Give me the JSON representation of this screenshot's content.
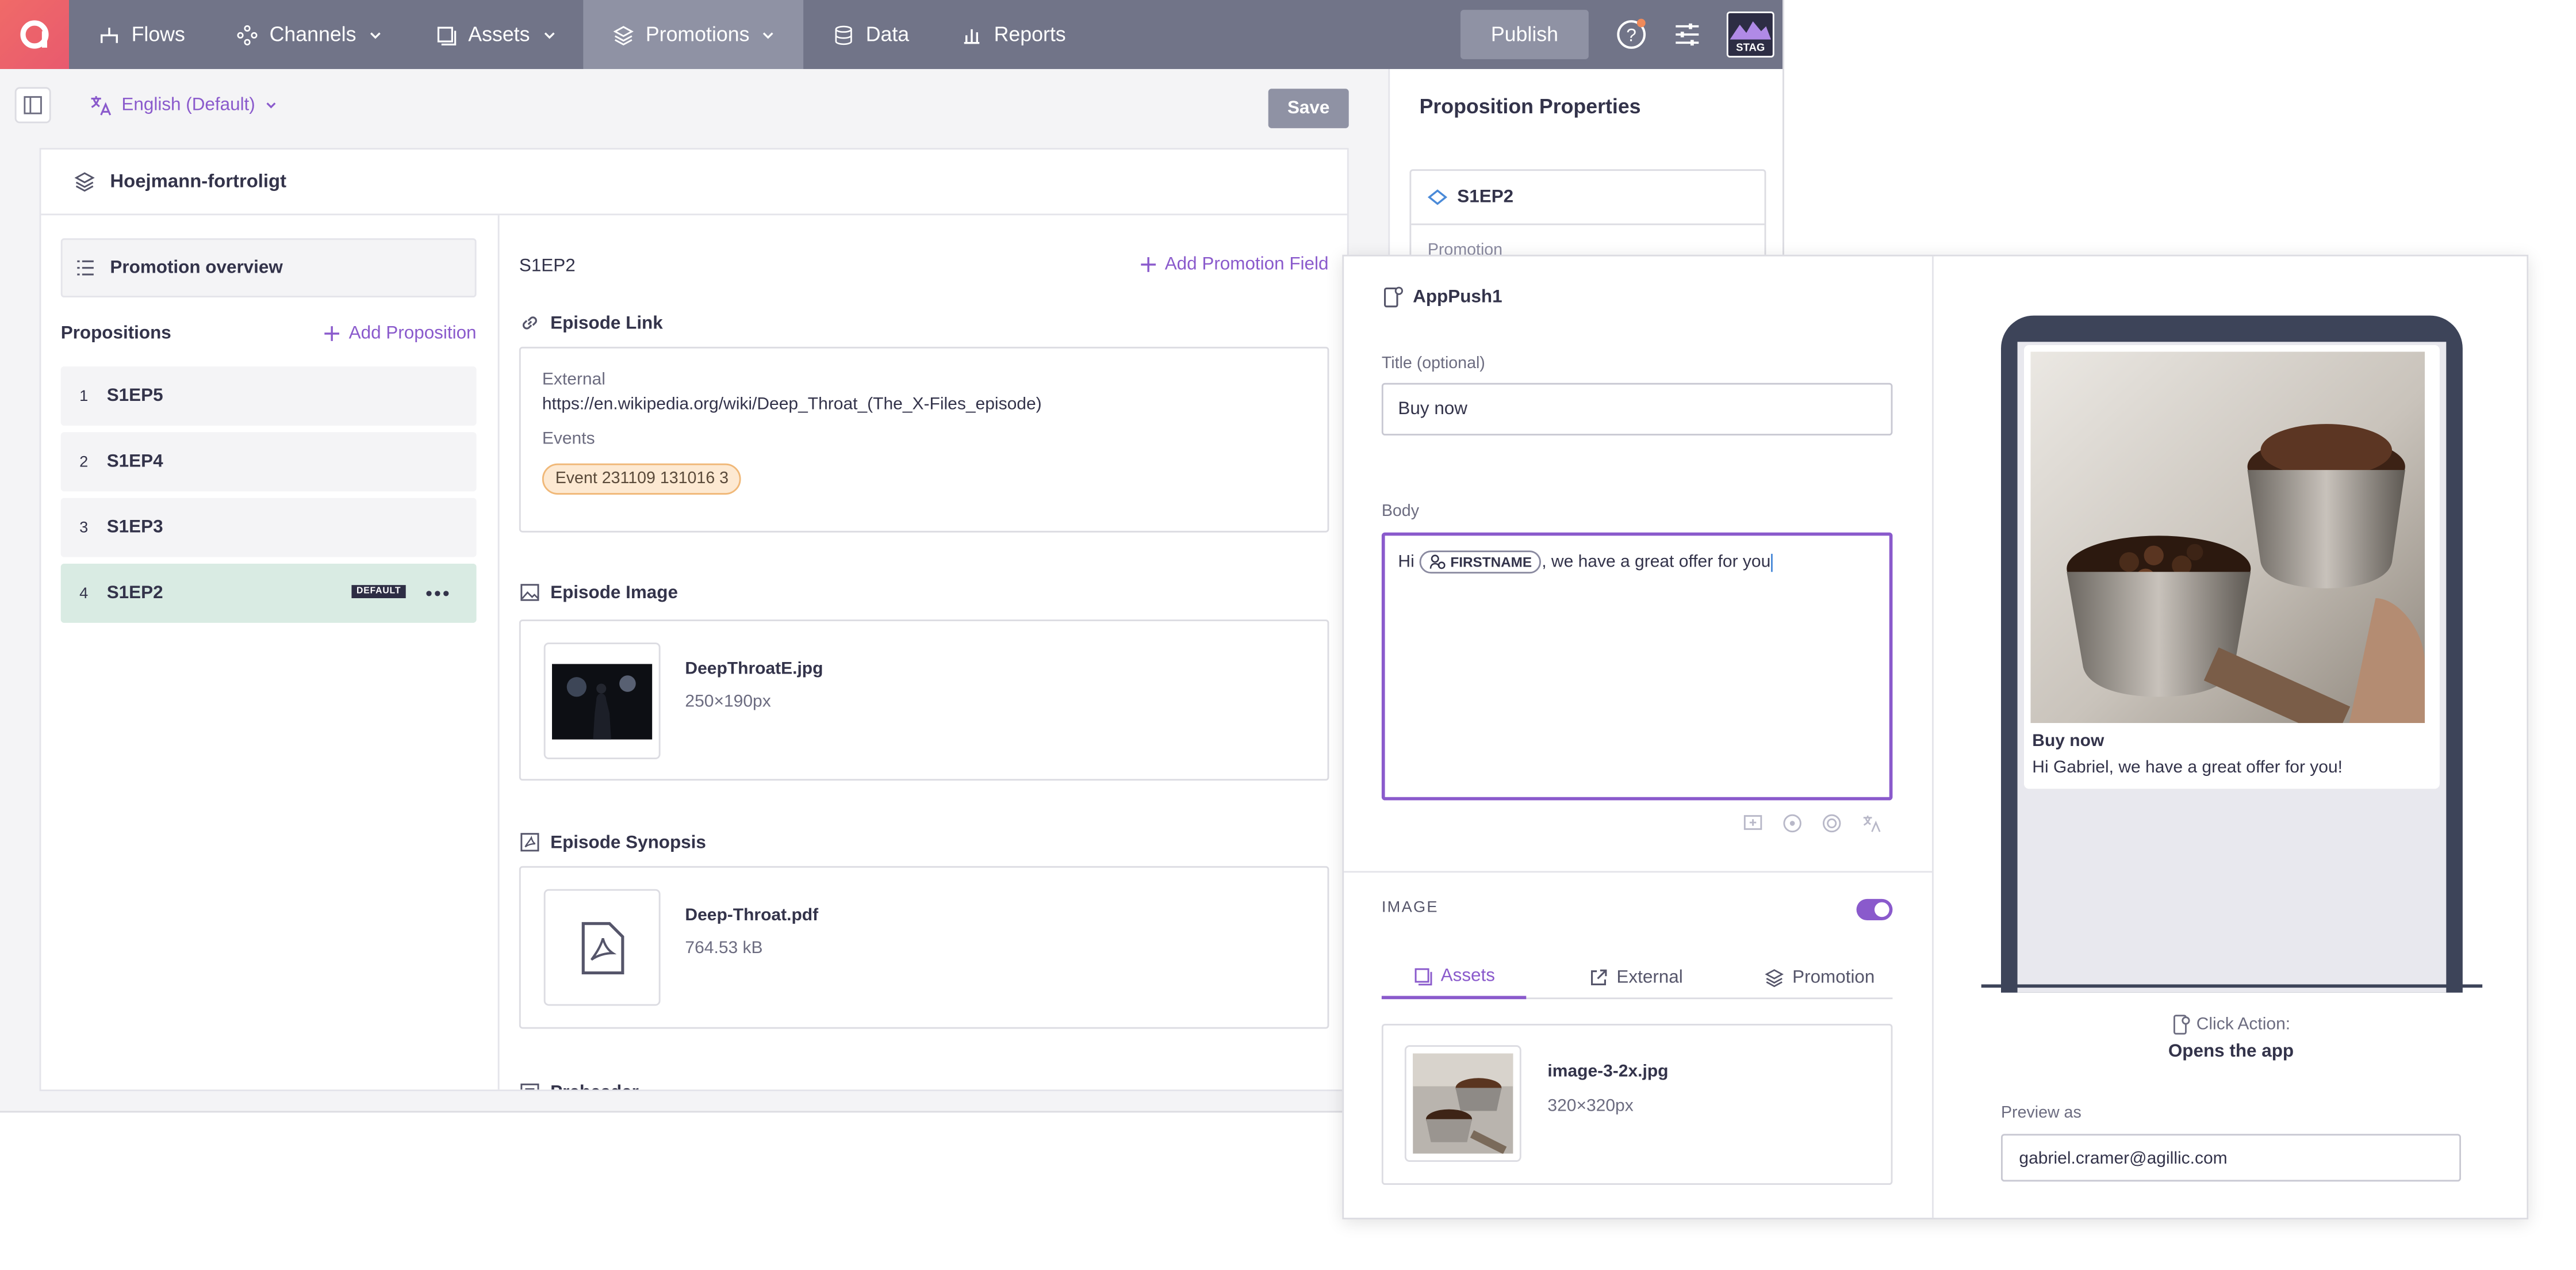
{
  "nav": {
    "items": [
      {
        "label": "Flows"
      },
      {
        "label": "Channels"
      },
      {
        "label": "Assets"
      },
      {
        "label": "Promotions"
      },
      {
        "label": "Data"
      },
      {
        "label": "Reports"
      }
    ],
    "publish": "Publish",
    "env_badge": "STAG"
  },
  "toolbar": {
    "language": "English (Default)",
    "save": "Save"
  },
  "promotion": {
    "name": "Hoejmann-fortroligt",
    "overview": "Promotion overview",
    "propositions_title": "Propositions",
    "add_proposition": "Add Proposition",
    "propositions": [
      {
        "n": "1",
        "label": "S1EP5"
      },
      {
        "n": "2",
        "label": "S1EP4"
      },
      {
        "n": "3",
        "label": "S1EP3"
      },
      {
        "n": "4",
        "label": "S1EP2",
        "badge": "DEFAULT"
      }
    ]
  },
  "detail": {
    "title": "S1EP2",
    "add_field": "Add Promotion Field",
    "episode_link": {
      "title": "Episode Link",
      "external_label": "External",
      "url": "https://en.wikipedia.org/wiki/Deep_Throat_(The_X-Files_episode)",
      "events_label": "Events",
      "event_chip": "Event 231109 131016 3"
    },
    "episode_image": {
      "title": "Episode Image",
      "file": "DeepThroatE.jpg",
      "size": "250×190px"
    },
    "episode_synopsis": {
      "title": "Episode Synopsis",
      "file": "Deep-Throat.pdf",
      "size": "764.53 kB"
    },
    "preheader": {
      "title": "Preheader"
    }
  },
  "properties": {
    "title": "Proposition Properties",
    "item": "S1EP2",
    "sub": "Promotion"
  },
  "push": {
    "name": "AppPush1",
    "title_label": "Title (optional)",
    "title_value": "Buy now",
    "body_label": "Body",
    "body_prefix": "Hi",
    "body_token": "FIRSTNAME",
    "body_suffix": ", we have a great offer for you",
    "image_label": "IMAGE",
    "tabs": [
      {
        "label": "Assets"
      },
      {
        "label": "External"
      },
      {
        "label": "Promotion"
      }
    ],
    "asset_file": "image-3-2x.jpg",
    "asset_size": "320×320px"
  },
  "preview": {
    "notif_title": "Buy now",
    "notif_body": "Hi Gabriel, we have a great offer for you!",
    "click_action_label": "Click Action:",
    "click_action_value": "Opens the app",
    "preview_as_label": "Preview as",
    "preview_as_value": "gabriel.cramer@agillic.com"
  },
  "colors": {
    "nav_bg": "#717488",
    "accent": "#8a5acc",
    "selected_row": "#d9ebe3",
    "logo": "#f06a68"
  }
}
